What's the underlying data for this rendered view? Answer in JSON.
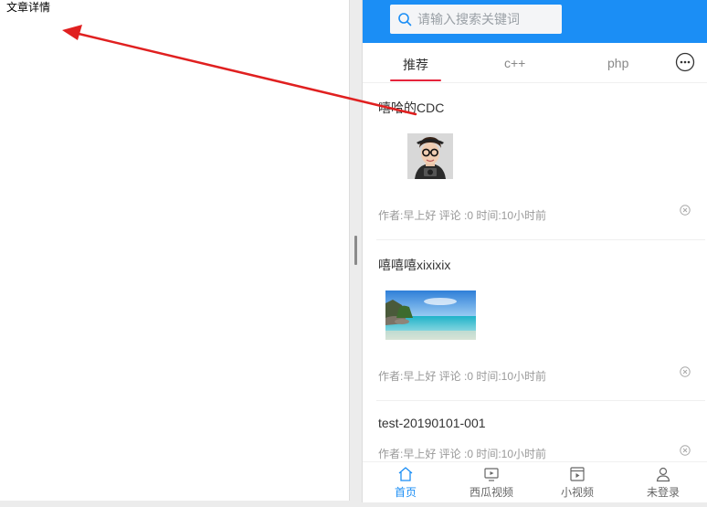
{
  "left_panel": {
    "title": "文章详情"
  },
  "search": {
    "placeholder": "请输入搜索关键词"
  },
  "tabs": [
    {
      "label": "推荐",
      "active": true
    },
    {
      "label": "c++",
      "active": false
    },
    {
      "label": "php",
      "active": false
    }
  ],
  "articles": [
    {
      "title": "嘻哈的CDC",
      "meta": "作者:早上好 评论 :0 时间:10小时前"
    },
    {
      "title": "嘻嘻嘻xixixix",
      "meta": "作者:早上好 评论 :0 时间:10小时前"
    },
    {
      "title": "test-20190101-001",
      "meta": "作者:早上好 评论 :0 时间:10小时前"
    }
  ],
  "bottom_nav": [
    {
      "label": "首页",
      "icon": "home-icon",
      "active": true
    },
    {
      "label": "西瓜视频",
      "icon": "tv-icon",
      "active": false
    },
    {
      "label": "小视频",
      "icon": "video-icon",
      "active": false
    },
    {
      "label": "未登录",
      "icon": "user-icon",
      "active": false
    }
  ],
  "colors": {
    "accent": "#1b8ef5",
    "tab_underline": "#e5243b",
    "arrow": "#e02020"
  }
}
